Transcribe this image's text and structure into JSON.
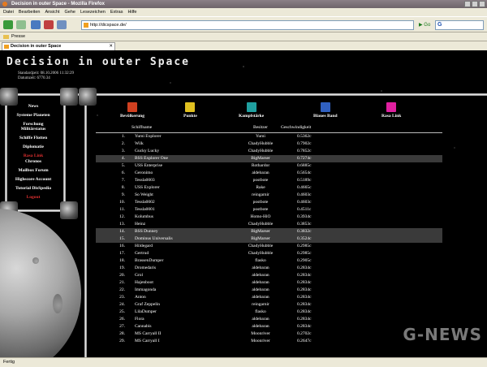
{
  "window": {
    "title": "Decision in outer Space - Mozilla Firefox"
  },
  "menu": [
    "Datei",
    "Bearbeiten",
    "Ansicht",
    "Gehe",
    "Lesezeichen",
    "Extras",
    "Hilfe"
  ],
  "toolbar": {
    "url": "http://dicspace.de/",
    "search_glyph": "G"
  },
  "bookmarks": {
    "folder": "Presse"
  },
  "tab": {
    "label": "Decision in outer Space",
    "close": "✕"
  },
  "site": {
    "logo": "Decision in outer Space",
    "stand_label": "Standardzeit:",
    "stand_value": "08.10.2006 11:32:29",
    "date_label": "Datumzeit:",
    "date_value": "6770.34"
  },
  "nav": [
    {
      "label": "News"
    },
    {
      "label": "Systeme Planeten"
    },
    {
      "label": "Forschung Militärstatus"
    },
    {
      "label": "Schiffe Flotten"
    },
    {
      "label": "Diplomatie"
    },
    {
      "label": "Rasa Link",
      "highlight": true
    },
    {
      "label": "Chronos"
    },
    {
      "label": "Mailbox Forum"
    },
    {
      "label": "Highscore Account"
    },
    {
      "label": "Tutorial DisSpedia"
    },
    {
      "label": "Logout",
      "highlight": true
    }
  ],
  "icons": [
    {
      "label": "Bevölkerung",
      "icon": "population-icon",
      "color": "#d04020"
    },
    {
      "label": "Punkte",
      "icon": "dice-icon",
      "color": "#e0c020"
    },
    {
      "label": "Kampfstärke",
      "icon": "battle-icon",
      "color": "#20a0a0"
    },
    {
      "label": "Blaues Band",
      "icon": "ribbon-icon",
      "color": "#3060c0"
    },
    {
      "label": "Rasa Link",
      "icon": "rasa-link-icon",
      "color": "#e020a0"
    }
  ],
  "table": {
    "headers": [
      "Schiffname",
      "Besitzer",
      "Geschwindigkeit"
    ],
    "rows": [
      {
        "n": "1.",
        "name": "Yumi Explorer",
        "owner": "Yumi",
        "speed": "0.5362c"
      },
      {
        "n": "2.",
        "name": "Wilk",
        "owner": "ChadyHubble",
        "speed": "0.7902c"
      },
      {
        "n": "3.",
        "name": "Gucky Lucky",
        "owner": "ChadyHubble",
        "speed": "0.7852c"
      },
      {
        "n": "4.",
        "name": "BSS Explorer One",
        "owner": "BigMarser",
        "speed": "0.7274c",
        "hl": true
      },
      {
        "n": "5.",
        "name": "USS Enterprise",
        "owner": "Rothardor",
        "speed": "0.6885c"
      },
      {
        "n": "6.",
        "name": "Geronimo",
        "owner": "aldebaran",
        "speed": "0.5654c"
      },
      {
        "n": "7.",
        "name": "Tessla0003",
        "owner": "postbote",
        "speed": "0.5189c"
      },
      {
        "n": "8.",
        "name": "USS Explorer",
        "owner": "Rake",
        "speed": "0.4665c"
      },
      {
        "n": "9.",
        "name": "So Weight",
        "owner": "reingarnir",
        "speed": "0.4603c"
      },
      {
        "n": "10.",
        "name": "Tessla0002",
        "owner": "postbote",
        "speed": "0.4603c"
      },
      {
        "n": "11.",
        "name": "Tessla0001",
        "owner": "postbote",
        "speed": "0.4511c"
      },
      {
        "n": "12.",
        "name": "Kolumbus",
        "owner": "Homo-HiO",
        "speed": "0.3934c"
      },
      {
        "n": "13.",
        "name": "Heinz",
        "owner": "ChadyHubble",
        "speed": "0.3853c"
      },
      {
        "n": "14.",
        "name": "BSS Dunney",
        "owner": "BigMarser",
        "speed": "0.3832c",
        "hl": true
      },
      {
        "n": "15.",
        "name": "Dominus Universalis",
        "owner": "BigMarser",
        "speed": "0.3524c",
        "hl": true
      },
      {
        "n": "16.",
        "name": "Hildegard",
        "owner": "ChadyHubble",
        "speed": "0.2985c"
      },
      {
        "n": "17.",
        "name": "Gertrud",
        "owner": "ChadyHubble",
        "speed": "0.2985c"
      },
      {
        "n": "18.",
        "name": "BrassenDumper",
        "owner": "flasko",
        "speed": "0.2905c"
      },
      {
        "n": "19.",
        "name": "Dromedaris",
        "owner": "aldebaran",
        "speed": "0.2834c"
      },
      {
        "n": "20.",
        "name": "Grol",
        "owner": "aldebaran",
        "speed": "0.2834c"
      },
      {
        "n": "21.",
        "name": "Hajenboot",
        "owner": "aldebaran",
        "speed": "0.2834c"
      },
      {
        "n": "22.",
        "name": "Immagonda",
        "owner": "aldebaran",
        "speed": "0.2834c"
      },
      {
        "n": "23.",
        "name": "Anton",
        "owner": "aldebaran",
        "speed": "0.2834c"
      },
      {
        "n": "24.",
        "name": "Graf Zeppelin",
        "owner": "reingarnir",
        "speed": "0.2834c"
      },
      {
        "n": "25.",
        "name": "LilaDumper",
        "owner": "flasko",
        "speed": "0.2834c"
      },
      {
        "n": "26.",
        "name": "Flora",
        "owner": "aldebaran",
        "speed": "0.2834c"
      },
      {
        "n": "27.",
        "name": "Cannabis",
        "owner": "aldebaran",
        "speed": "0.2834c"
      },
      {
        "n": "28.",
        "name": "MS Carryall II",
        "owner": "Moonriver",
        "speed": "0.2702c"
      },
      {
        "n": "29.",
        "name": "MS Carryall I",
        "owner": "Moonriver",
        "speed": "0.2647c"
      }
    ]
  },
  "watermark": "G-NEWS",
  "status": {
    "text": "Fertig"
  }
}
